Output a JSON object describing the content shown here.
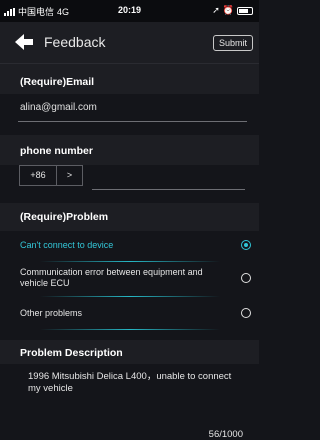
{
  "status_bar": {
    "carrier": "中国电信",
    "network": "4G",
    "time": "20:19"
  },
  "header": {
    "title": "Feedback",
    "submit_label": "Submit"
  },
  "email": {
    "label": "(Require)Email",
    "value": "alina@gmail.com"
  },
  "phone": {
    "label": "phone number",
    "country_code": "+86",
    "chevron": ">",
    "value": ""
  },
  "problem": {
    "label": "(Require)Problem",
    "options": [
      {
        "label": "Can't connect to device",
        "selected": true
      },
      {
        "label": "Communication error between equipment and vehicle ECU",
        "selected": false
      },
      {
        "label": "Other problems",
        "selected": false
      }
    ]
  },
  "description": {
    "label": "Problem Description",
    "text": "1996 Mitsubishi Delica L400，unable to connect my vehicle",
    "char_count": "56/1000"
  },
  "colors": {
    "accent": "#30c5d6",
    "background": "#14151a",
    "band": "#1d1e23"
  }
}
